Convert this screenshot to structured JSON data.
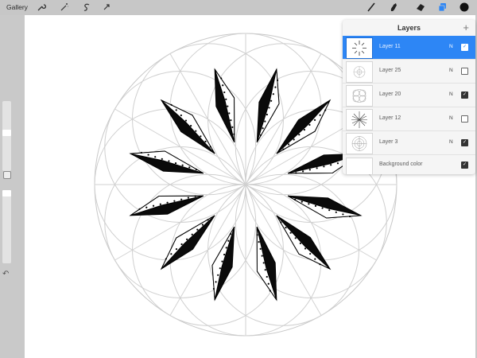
{
  "topbar": {
    "gallery_label": "Gallery",
    "tools_left": [
      "wrench-icon",
      "magic-wand-icon",
      "selection-icon",
      "transform-arrow-icon"
    ],
    "tools_right": [
      "brush-icon",
      "smudge-icon",
      "eraser-icon",
      "layers-icon",
      "color-icon"
    ],
    "color": "#111111",
    "layers_accent": "#2d86f5"
  },
  "layers_panel": {
    "title": "Layers",
    "add_icon": "plus-icon",
    "layers": [
      {
        "name": "Layer 11",
        "blend": "N",
        "visible": true,
        "active": true
      },
      {
        "name": "Layer 25",
        "blend": "N",
        "visible": false,
        "active": false
      },
      {
        "name": "Layer 20",
        "blend": "N",
        "visible": true,
        "active": false
      },
      {
        "name": "Layer 12",
        "blend": "N",
        "visible": false,
        "active": false
      },
      {
        "name": "Layer 3",
        "blend": "N",
        "visible": true,
        "active": false
      }
    ],
    "background": {
      "name": "Background color",
      "visible": true
    }
  },
  "sidebar": {
    "undo_icon": "undo-icon",
    "modify_icon": "modify-button-icon"
  }
}
